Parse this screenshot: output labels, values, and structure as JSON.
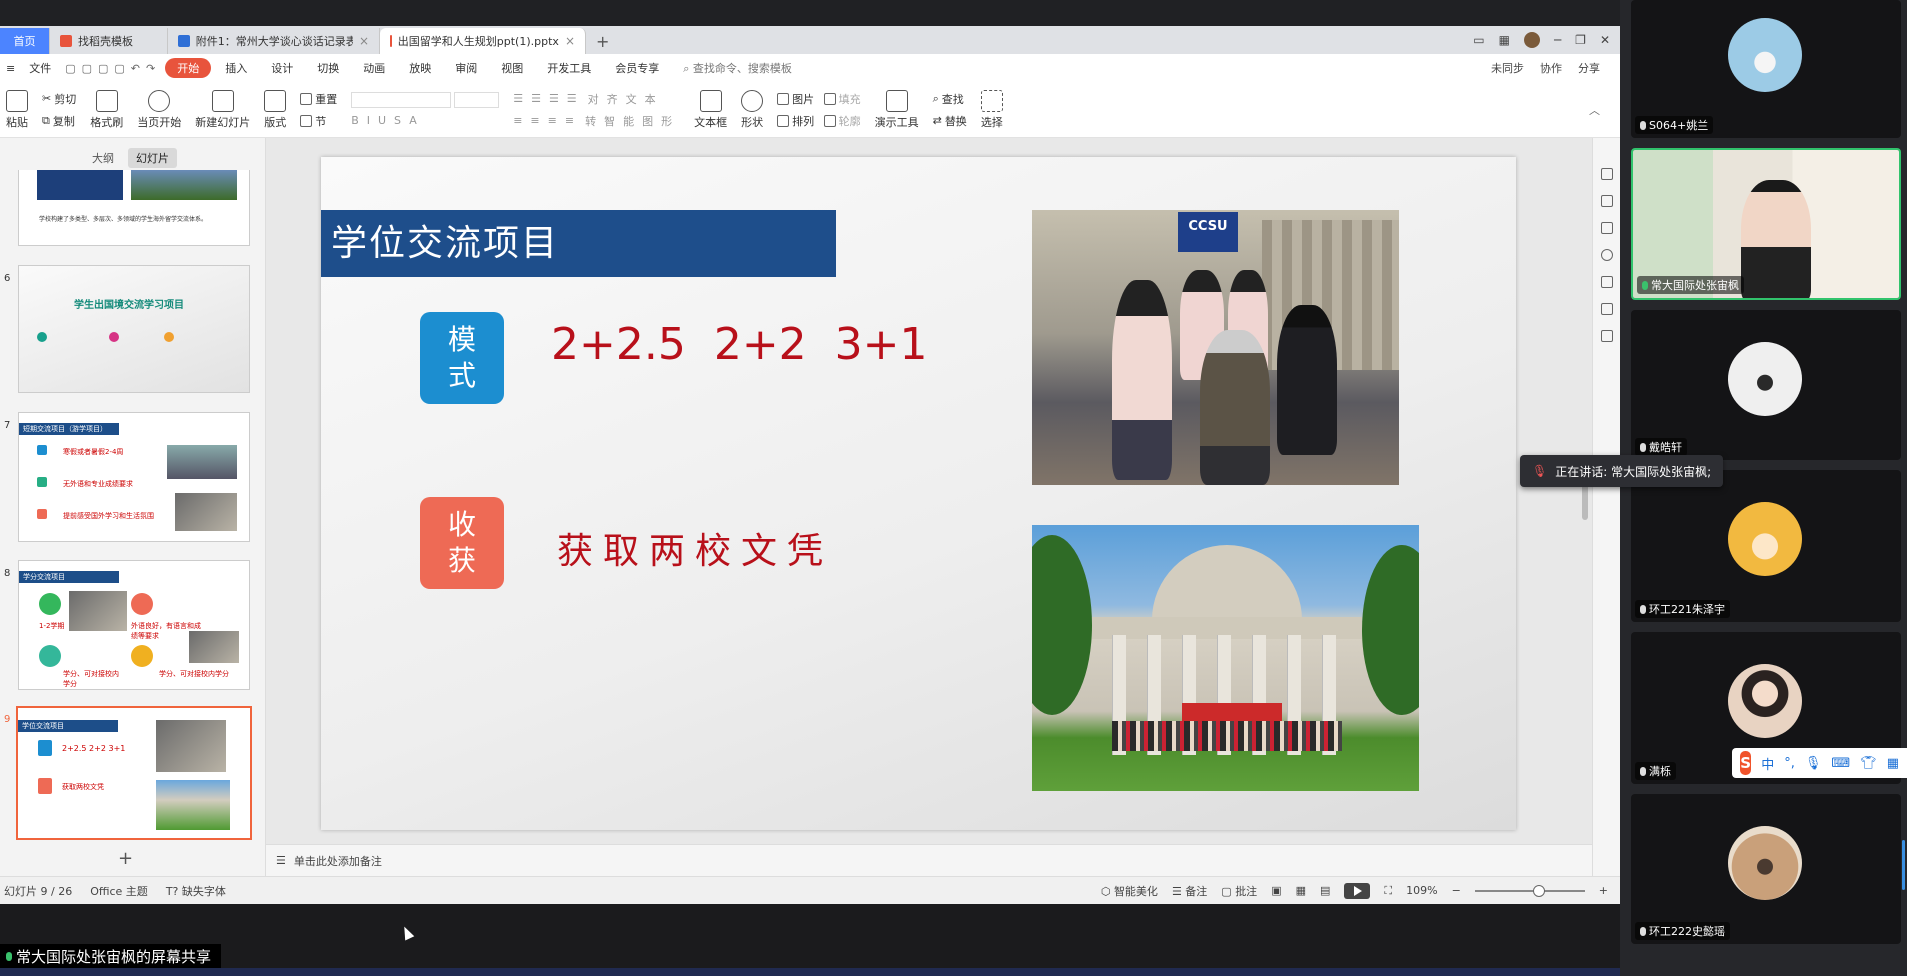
{
  "tabs": {
    "home": "首页",
    "items": [
      {
        "label": "找稻壳模板",
        "color": "#e8543c"
      },
      {
        "label": "附件1：常州大学谈心谈话记录表",
        "color": "#2f6fd6"
      },
      {
        "label": "出国留学和人生规划ppt(1).pptx",
        "color": "#e8543c"
      }
    ],
    "add": "+"
  },
  "menu": {
    "file": "文件",
    "items": [
      "开始",
      "插入",
      "设计",
      "切换",
      "动画",
      "放映",
      "审阅",
      "视图",
      "开发工具",
      "会员专享"
    ],
    "search": "查找命令、搜索模板",
    "right": [
      "未同步",
      "协作",
      "分享"
    ]
  },
  "toolbar": {
    "paste": "粘贴",
    "cut": "剪切",
    "copy": "复制",
    "format_painter": "格式刷",
    "from_current": "当页开始",
    "new_slide": "新建幻灯片",
    "layout": "版式",
    "section": "节",
    "reset": "重置",
    "align_text": "对齐文本",
    "smart_graphic": "转智能图形",
    "textbox": "文本框",
    "shape": "形状",
    "picture": "图片",
    "fill": "填充",
    "arrange": "排列",
    "outline": "轮廓",
    "present_tools": "演示工具",
    "find": "查找",
    "replace": "替换",
    "select": "选择"
  },
  "left_panel": {
    "tab_outline": "大纲",
    "tab_slides": "幻灯片",
    "thumbs": [
      {
        "num": "",
        "text": "学校构建了多类型、多层次、多领域的学生海外留学交流体系。"
      },
      {
        "num": "6",
        "title": "学生出国境交流学习项目"
      },
      {
        "num": "7",
        "title": "短期交流项目（游学项目）",
        "lines": [
          "寒假或者暑假2-4周",
          "无外语和专业成绩要求",
          "提前感受国外学习和生活氛围"
        ]
      },
      {
        "num": "8",
        "title": "学分交流项目",
        "lines": [
          "1-2学期",
          "外语良好，有语言和成绩等要求",
          "学分、可对接校内学分",
          "学分、可对接校内学分"
        ]
      },
      {
        "num": "9",
        "title": "学位交流项目",
        "lines": [
          "2+2.5  2+2  3+1",
          "获取两校文凭"
        ]
      }
    ],
    "add_slide": "+"
  },
  "slide": {
    "title": "学位交流项目",
    "mode_badge": [
      "模",
      "式"
    ],
    "mode_text": "2+2.5  2+2  3+1",
    "gain_badge": [
      "收",
      "获"
    ],
    "gain_text": "获取两校文凭",
    "photo1_sign": "CCSU"
  },
  "notes": {
    "placeholder": "单击此处添加备注"
  },
  "status": {
    "slide_count": "幻灯片 9 / 26",
    "theme": "Office 主题",
    "missing_font": "缺失字体",
    "beautify": "智能美化",
    "notes": "备注",
    "comments": "批注",
    "zoom": "109%"
  },
  "share_label": "常大国际处张宙枫的屏幕共享",
  "meeting": {
    "speaking_tip": "正在讲话: 常大国际处张宙枫;",
    "participants": [
      {
        "name": "S064+姚兰",
        "avatar_color": "#7fb7d8",
        "muted": true
      },
      {
        "name": "常大国际处张宙枫",
        "avatar_color": "#d9c9b4",
        "muted": false,
        "speaking": true
      },
      {
        "name": "戴皓轩",
        "avatar_color": "#e6e6e6",
        "muted": true
      },
      {
        "name": "环工221朱泽宇",
        "avatar_color": "#f2b940",
        "muted": true
      },
      {
        "name": "满栎",
        "avatar_color": "#e8d3c2",
        "muted": true
      },
      {
        "name": "环工222史懿瑶",
        "avatar_color": "#c9a07a",
        "muted": true
      }
    ]
  },
  "ime": {
    "logo": "S",
    "mode": "中",
    "punct": "°,"
  }
}
